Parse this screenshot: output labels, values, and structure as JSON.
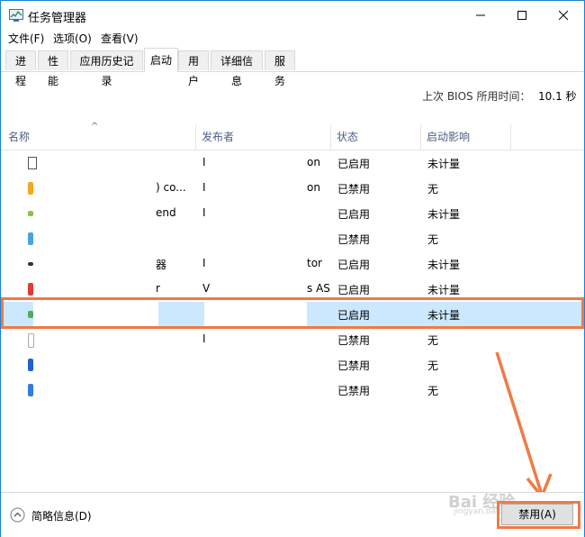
{
  "window": {
    "title": "任务管理器"
  },
  "menu": [
    "文件(F)",
    "选项(O)",
    "查看(V)"
  ],
  "tabs": [
    "进程",
    "性能",
    "应用历史记录",
    "启动",
    "用户",
    "详细信息",
    "服务"
  ],
  "active_tab": "启动",
  "bios": {
    "label": "上次 BIOS 所用时间：",
    "value": "10.1 秒"
  },
  "columns": {
    "name": "名称",
    "publisher": "发布者",
    "status": "状态",
    "impact": "启动影响"
  },
  "rows": [
    {
      "name": "",
      "pub_a": "I",
      "pub_b": "on",
      "status": "已启用",
      "impact": "未计量"
    },
    {
      "name": ") co...",
      "pub_a": "I",
      "pub_b": "on",
      "status": "已禁用",
      "impact": "无"
    },
    {
      "name": "end",
      "pub_a": "I",
      "pub_b": "",
      "status": "已启用",
      "impact": "未计量"
    },
    {
      "name": "",
      "pub_a": "",
      "pub_b": "",
      "status": "已禁用",
      "impact": "无"
    },
    {
      "name": "器",
      "pub_a": "I",
      "pub_b": "tor",
      "status": "已启用",
      "impact": "未计量"
    },
    {
      "name": "r",
      "pub_a": "V",
      "pub_b": "s AS",
      "status": "已启用",
      "impact": "未计量"
    },
    {
      "name": "",
      "pub_a": "",
      "pub_b": "",
      "status": "已启用",
      "impact": "未计量"
    },
    {
      "name": "",
      "pub_a": "I",
      "pub_b": "",
      "status": "已禁用",
      "impact": "无"
    },
    {
      "name": "",
      "pub_a": "",
      "pub_b": "",
      "status": "已禁用",
      "impact": "无"
    },
    {
      "name": "",
      "pub_a": "",
      "pub_b": "",
      "status": "已禁用",
      "impact": "无"
    }
  ],
  "footer": {
    "fewer_details": "简略信息(D)",
    "disable_button": "禁用(A)",
    "watermark": "Bai 经验",
    "watermark_sub": "jingyan.baidu.com"
  },
  "colors": {
    "accent_annotation": "#f07a45",
    "selected_row": "#cce8ff",
    "header_text": "#4d6082"
  }
}
